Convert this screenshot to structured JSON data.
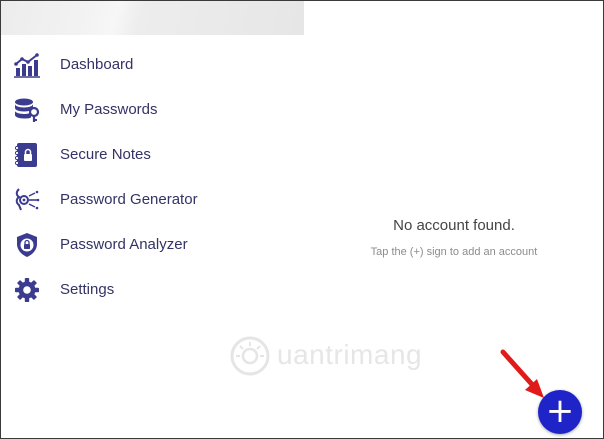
{
  "sidebar": {
    "items": [
      {
        "label": "Dashboard",
        "icon": "dashboard-icon"
      },
      {
        "label": "My Passwords",
        "icon": "passwords-database-icon"
      },
      {
        "label": "Secure Notes",
        "icon": "secure-notes-icon"
      },
      {
        "label": "Password Generator",
        "icon": "password-generator-icon"
      },
      {
        "label": "Password Analyzer",
        "icon": "shield-lock-icon"
      },
      {
        "label": "Settings",
        "icon": "gear-icon"
      }
    ]
  },
  "main": {
    "empty_title": "No account found.",
    "empty_subtitle": "Tap the (+) sign to add an account"
  },
  "fab": {
    "label": "+"
  },
  "watermark": {
    "text": "uantrimang"
  },
  "colors": {
    "nav_icon": "#3b3b8f",
    "nav_text": "#333366",
    "fab": "#1f24c9",
    "annotation_arrow": "#e11a1a"
  }
}
